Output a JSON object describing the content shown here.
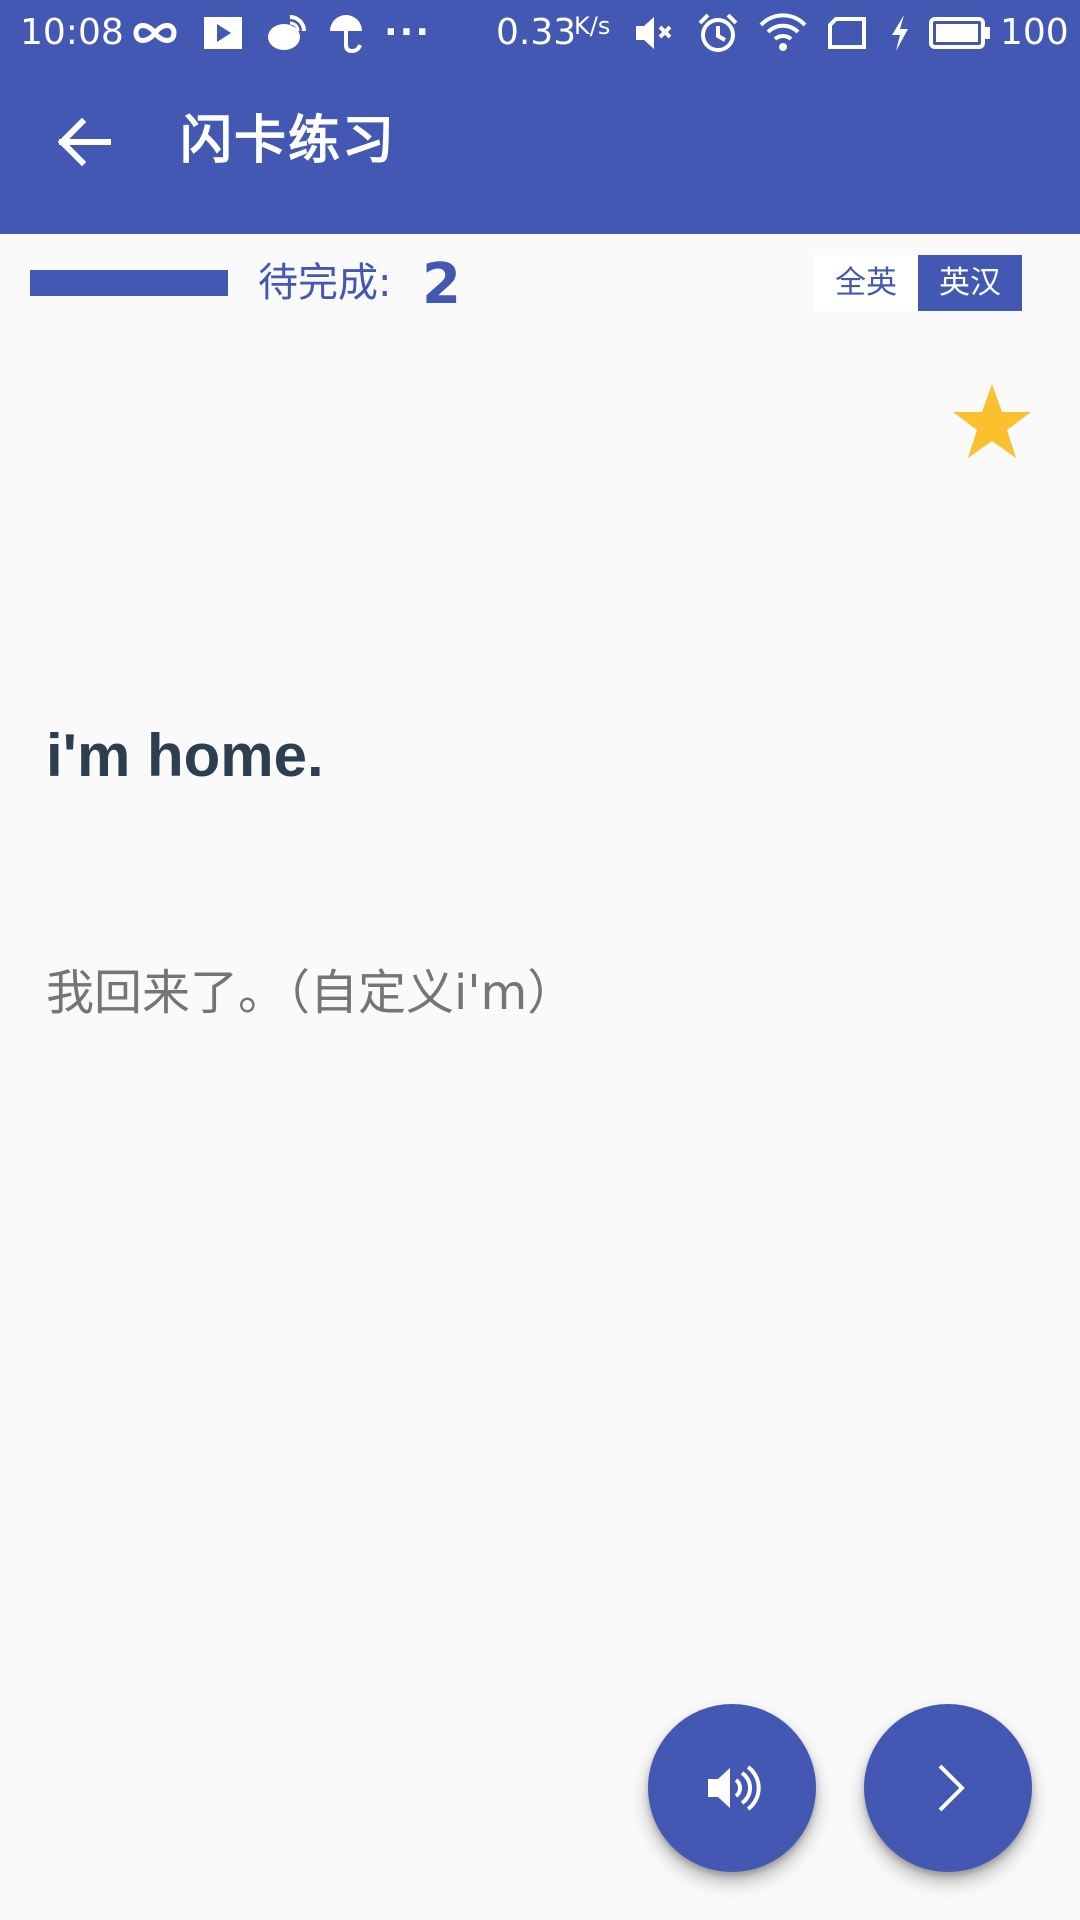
{
  "status_bar": {
    "time": "10:08",
    "more": "···",
    "net_speed": "0.33",
    "net_unit": "K/s",
    "battery": "100",
    "icons": [
      "infinity-icon",
      "play-icon",
      "weibo-icon",
      "umbrella-icon",
      "mute-icon",
      "alarm-icon",
      "wifi-icon",
      "sim-icon",
      "charging-icon",
      "battery-icon"
    ]
  },
  "app_bar": {
    "title": "闪卡练习",
    "back_icon": "arrow-back-icon"
  },
  "progress": {
    "label": "待完成:",
    "count": "2"
  },
  "mode_toggle": {
    "options": [
      "全英",
      "英汉"
    ],
    "selected": "英汉"
  },
  "card": {
    "word": "i'm home.",
    "meaning": "我回来了。（自定义i'm）",
    "starred": true,
    "star_icon": "star-icon"
  },
  "actions": {
    "speak_icon": "speaker-icon",
    "next_icon": "chevron-right-icon"
  },
  "colors": {
    "primary": "#4358b3",
    "star": "#fbc02d",
    "word": "#2c3e50",
    "meaning": "#757575",
    "background": "#fafafa"
  }
}
